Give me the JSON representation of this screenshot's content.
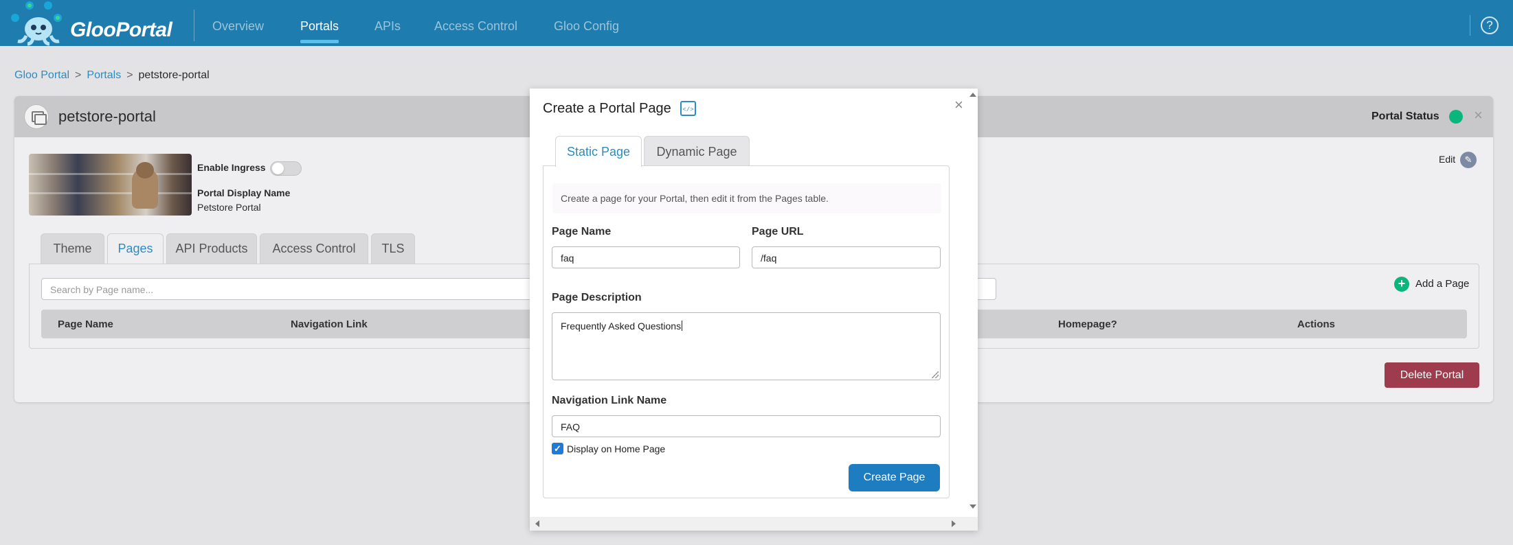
{
  "app": {
    "brand": "GlooPortal",
    "nav": [
      "Overview",
      "Portals",
      "APIs",
      "Access Control",
      "Gloo Config"
    ],
    "active_nav": "Portals",
    "help_glyph": "?"
  },
  "breadcrumb": [
    "Gloo Portal",
    "Portals",
    "petstore-portal"
  ],
  "breadcrumb_separator": ">",
  "portal": {
    "title": "petstore-portal",
    "status_label": "Portal Status",
    "status_color": "#0bb57c",
    "enable_ingress_label": "Enable Ingress",
    "enable_ingress": false,
    "display_name_label": "Portal Display Name",
    "display_name": "Petstore Portal",
    "edit_label": "Edit",
    "tabs": [
      "Theme",
      "Pages",
      "API Products",
      "Access Control",
      "TLS"
    ],
    "active_tab": "Pages",
    "search_placeholder": "Search by Page name...",
    "add_page_label": "Add a Page",
    "columns": [
      "Page Name",
      "Navigation Link",
      "Homepage?",
      "Actions"
    ],
    "delete_label": "Delete Portal"
  },
  "modal": {
    "title": "Create a Portal Page",
    "tabs": [
      "Static Page",
      "Dynamic Page"
    ],
    "active_tab": "Static Page",
    "info": "Create a page for your Portal, then edit it from the Pages table.",
    "page_name_label": "Page Name",
    "page_name_value": "faq",
    "page_url_label": "Page URL",
    "page_url_value": "/faq",
    "description_label": "Page Description",
    "description_value": "Frequently Asked Questions",
    "nav_link_label": "Navigation Link Name",
    "nav_link_value": "FAQ",
    "display_home_label": "Display on Home Page",
    "display_home_checked": true,
    "create_label": "Create Page",
    "close_glyph": "×"
  },
  "colors": {
    "brand_bar": "#1e7cae",
    "accent": "#2a8cc2",
    "delete": "#9e3b4c",
    "primary_button": "#1e7cc0"
  }
}
